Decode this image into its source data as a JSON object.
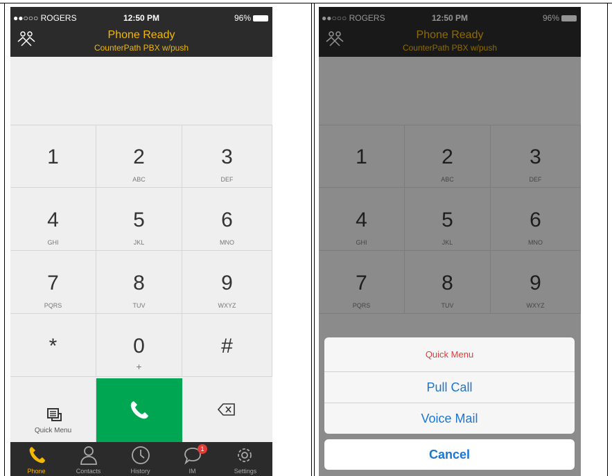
{
  "status": {
    "carrier": "●●○○○ ROGERS",
    "time": "12:50 PM",
    "battery": "96%"
  },
  "header": {
    "title": "Phone Ready",
    "subtitle": "CounterPath PBX w/push"
  },
  "keys": [
    {
      "digit": "1",
      "letters": ""
    },
    {
      "digit": "2",
      "letters": "ABC"
    },
    {
      "digit": "3",
      "letters": "DEF"
    },
    {
      "digit": "4",
      "letters": "GHI"
    },
    {
      "digit": "5",
      "letters": "JKL"
    },
    {
      "digit": "6",
      "letters": "MNO"
    },
    {
      "digit": "7",
      "letters": "PQRS"
    },
    {
      "digit": "8",
      "letters": "TUV"
    },
    {
      "digit": "9",
      "letters": "WXYZ"
    },
    {
      "digit": "*",
      "letters": ""
    },
    {
      "digit": "0",
      "letters": "+"
    },
    {
      "digit": "#",
      "letters": ""
    }
  ],
  "quick_menu_label": "Quick Menu",
  "tabs": [
    {
      "label": "Phone",
      "icon": "phone-icon"
    },
    {
      "label": "Contacts",
      "icon": "contacts-icon"
    },
    {
      "label": "History",
      "icon": "history-icon"
    },
    {
      "label": "IM",
      "icon": "chat-icon",
      "badge": "1"
    },
    {
      "label": "Settings",
      "icon": "gear-icon"
    }
  ],
  "sheet": {
    "title": "Quick Menu",
    "items": [
      "Pull Call",
      "Voice Mail"
    ],
    "cancel": "Cancel"
  },
  "colors": {
    "accent": "#f5b800",
    "call_green": "#00a651",
    "link_blue": "#1a76d2",
    "badge_red": "#e53935"
  }
}
